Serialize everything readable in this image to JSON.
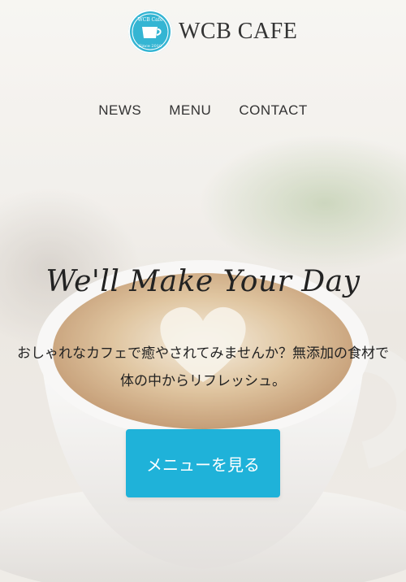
{
  "header": {
    "logo": {
      "badge_text_top": "WCB Cafe",
      "badge_text_bottom": "Since 2010",
      "brand": "WCB CAFE"
    },
    "nav": [
      {
        "label": "NEWS"
      },
      {
        "label": "MENU"
      },
      {
        "label": "CONTACT"
      }
    ]
  },
  "hero": {
    "headline": "We'll Make Your Day",
    "description": "おしゃれなカフェで癒やされてみませんか？無添加の食材で体の中からリフレッシュ。",
    "cta_label": "メニューを見る"
  },
  "colors": {
    "accent": "#1fb2d9",
    "logo_badge": "#34b5d3",
    "text": "#333333"
  }
}
